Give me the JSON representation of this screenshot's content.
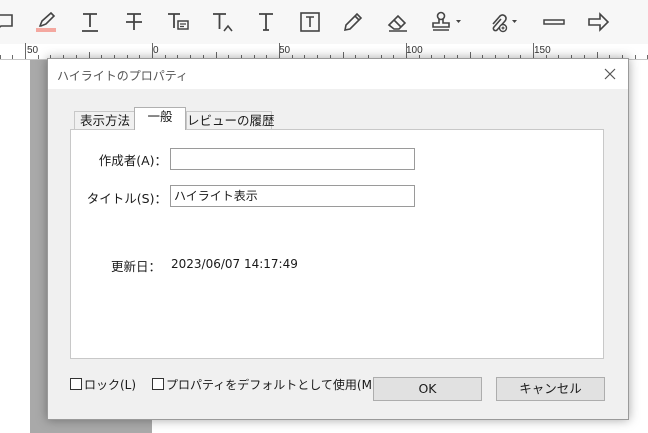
{
  "toolbar": {
    "icons": [
      "comment-icon",
      "highlighter-icon",
      "underline-text-icon",
      "strikethrough-text-icon",
      "replace-text-icon",
      "insert-text-icon",
      "text-icon",
      "textbox-icon",
      "pencil-icon",
      "eraser-icon",
      "stamp-icon",
      "attach-icon",
      "line-icon",
      "arrow-icon"
    ],
    "accent_color": "#f4a8a0"
  },
  "ruler": {
    "labels": [
      "50",
      "0",
      "50",
      "100",
      "150"
    ]
  },
  "dialog": {
    "title": "ハイライトのプロパティ",
    "close_glyph": "✕",
    "tabs": [
      {
        "label": "表示方法"
      },
      {
        "label": "一般"
      },
      {
        "label": "レビューの履歴"
      }
    ],
    "active_tab": "一般",
    "fields": {
      "author_label": "作成者(A)：",
      "author_value": "",
      "title_label": "タイトル(S)：",
      "title_value": "ハイライト表示",
      "modified_label": "更新日：",
      "modified_value": "2023/06/07 14:17:49"
    },
    "lock_label": "ロック(L)",
    "default_label": "プロパティをデフォルトとして使用(M)",
    "ok_label": "OK",
    "cancel_label": "キャンセル"
  }
}
